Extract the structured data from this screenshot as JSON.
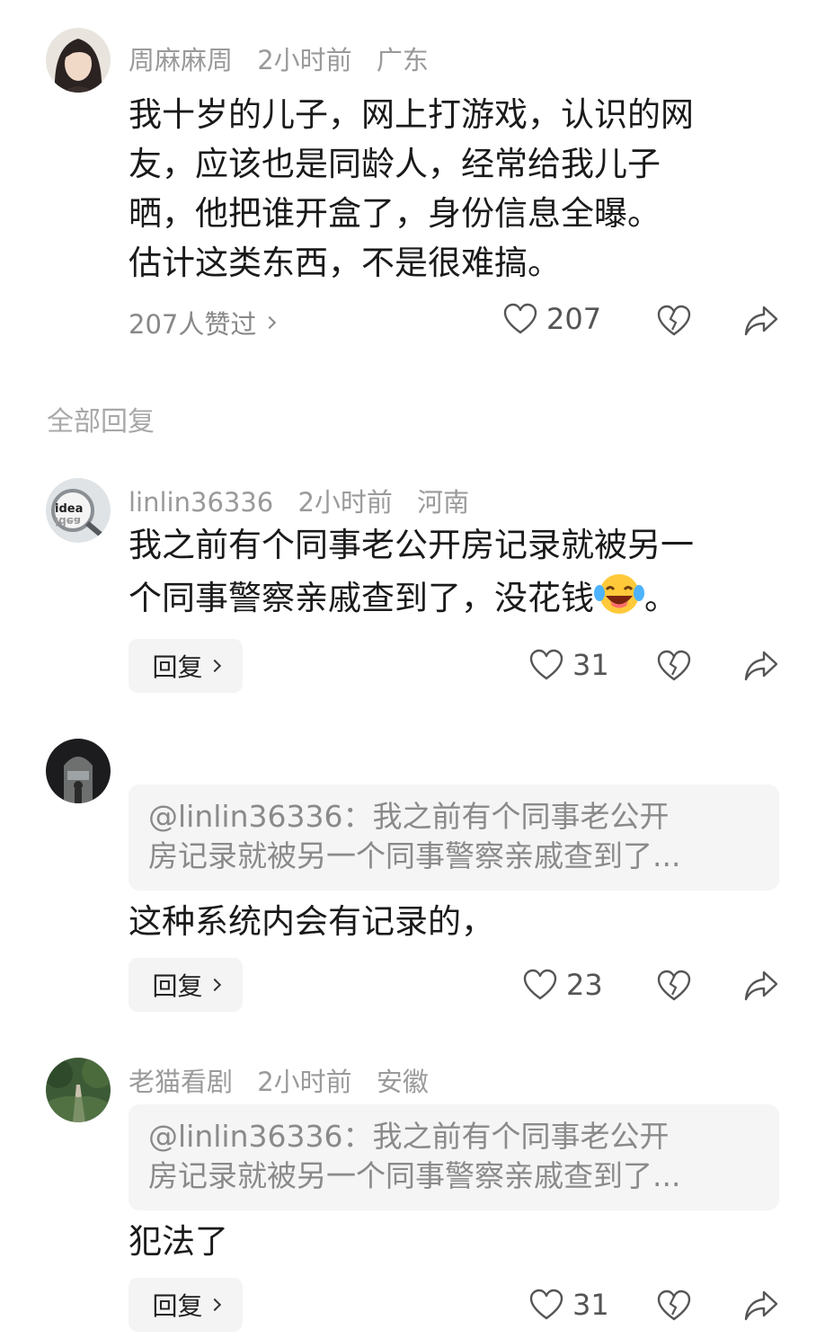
{
  "main_comment": {
    "author": "周麻麻周",
    "time": "2小时前",
    "location": "广东",
    "lines": [
      "我十岁的儿子，网上打游戏，认识的网",
      "友，应该也是同龄人，经常给我儿子",
      "晒，他把谁开盒了，身份信息全曝。",
      "估计这类东西，不是很难搞。"
    ],
    "likers_text": "207人赞过",
    "like_count": "207"
  },
  "section_label": "全部回复",
  "replies": [
    {
      "author": "linlin36336",
      "time": "2小时前",
      "location": "河南",
      "line1": "我之前有个同事老公开房记录就被另一",
      "line2": "个同事警察亲戚查到了，没花钱",
      "line2_end": "。",
      "reply_label": "回复",
      "like_count": "31"
    },
    {
      "quote_line1": "@linlin36336：我之前有个同事老公开",
      "quote_line2": "房记录就被另一个同事警察亲戚查到了...",
      "text": "这种系统内会有记录的，",
      "reply_label": "回复",
      "like_count": "23"
    },
    {
      "author": "老猫看剧",
      "time": "2小时前",
      "location": "安徽",
      "quote_line1": "@linlin36336：我之前有个同事老公开",
      "quote_line2": "房记录就被另一个同事警察亲戚查到了...",
      "text": "犯法了",
      "reply_label": "回复",
      "like_count": "31"
    }
  ],
  "avatar_texts": {
    "idea_top": "idea",
    "idea_bottom": "idea"
  },
  "icons": [
    "heart-icon",
    "broken-heart-icon",
    "share-icon",
    "chevron-right-icon",
    "laughing-tears-emoji"
  ],
  "colors": {
    "meta": "#9a9a9a",
    "quote_bg": "#f5f5f5",
    "reply_bg": "#f4f4f4"
  }
}
